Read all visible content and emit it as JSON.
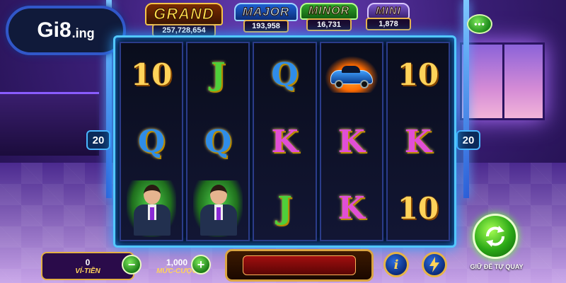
{
  "logo": {
    "main": "Gi8",
    "suffix": ".ing"
  },
  "jackpots": [
    {
      "title": "Grand",
      "value": "257,728,654"
    },
    {
      "title": "Major",
      "value": "193,958"
    },
    {
      "title": "Minor",
      "value": "16,731"
    },
    {
      "title": "Mini",
      "value": "1,878"
    }
  ],
  "menu": {
    "icon": "ellipsis-icon"
  },
  "paylines": {
    "left": "20",
    "right": "20"
  },
  "reels": [
    [
      "10",
      "Q",
      "man"
    ],
    [
      "J",
      "Q",
      "man"
    ],
    [
      "Q",
      "K",
      "J"
    ],
    [
      "car",
      "K",
      "K"
    ],
    [
      "10",
      "K",
      "10"
    ]
  ],
  "bottom": {
    "wallet_value": "0",
    "wallet_label": "VÍ-TIỀN",
    "bet_value": "1,000",
    "bet_label": "MỨC-CƯỢC",
    "minus": "−",
    "plus": "+",
    "info": "i"
  },
  "autospin": {
    "label": "GIỮ ĐỂ TỰ QUAY"
  },
  "colors": {
    "accent": "#52c8ff",
    "gold": "#e3b044",
    "green": "#2aa816"
  }
}
